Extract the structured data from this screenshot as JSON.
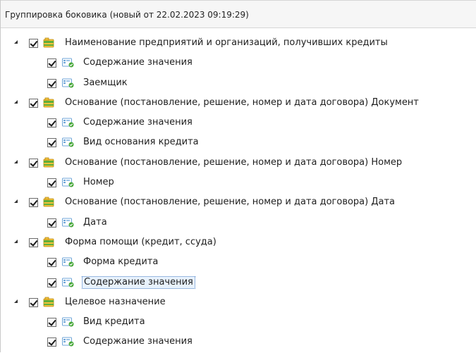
{
  "header": {
    "title": "Группировка боковика (новый от 22.02.2023 09:19:29)"
  },
  "tree": {
    "groups": [
      {
        "label": "Наименование предприятий и организаций, получивших кредиты",
        "children": [
          {
            "label": " Содержание значения"
          },
          {
            "label": "Заемщик"
          }
        ]
      },
      {
        "label": "Основание (постановление, решение, номер и дата договора) Документ",
        "children": [
          {
            "label": " Содержание значения"
          },
          {
            "label": "Вид основания кредита"
          }
        ]
      },
      {
        "label": "Основание (постановление, решение, номер и дата договора) Номер",
        "children": [
          {
            "label": "Номер"
          }
        ]
      },
      {
        "label": "Основание (постановление, решение, номер и дата договора) Дата",
        "children": [
          {
            "label": " Дата"
          }
        ]
      },
      {
        "label": "Форма помощи (кредит, ссуда)",
        "children": [
          {
            "label": "Форма кредита"
          },
          {
            "label": "Содержание значения",
            "selected": true
          }
        ]
      },
      {
        "label": "Целевое назначение",
        "children": [
          {
            "label": "Вид кредита"
          },
          {
            "label": " Содержание значения"
          }
        ]
      }
    ]
  },
  "icons": {
    "expander": "expanded-triangle-icon",
    "checkbox": "checkbox-checked-icon",
    "group": "group-folder-icon",
    "field": "field-attribute-icon"
  },
  "colors": {
    "selection_bg": "#e8f2fd",
    "selection_border": "#4a7ec4",
    "folder_green": "#5fae3a",
    "folder_yellow": "#f3c33b"
  }
}
